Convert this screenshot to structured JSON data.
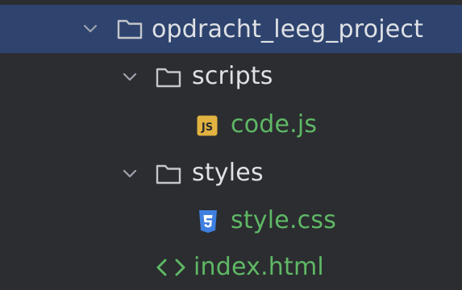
{
  "tree": {
    "items": [
      {
        "label": "opdracht_leeg_project",
        "type": "folder",
        "expanded": true,
        "selected": true,
        "icon": "folder-icon"
      },
      {
        "label": "scripts",
        "type": "folder",
        "expanded": true,
        "icon": "folder-icon"
      },
      {
        "label": "code.js",
        "type": "file",
        "icon": "js-file-icon",
        "icon_text": "JS"
      },
      {
        "label": "styles",
        "type": "folder",
        "expanded": true,
        "icon": "folder-icon"
      },
      {
        "label": "style.css",
        "type": "file",
        "icon": "css-file-icon"
      },
      {
        "label": "index.html",
        "type": "file",
        "icon": "html-file-icon",
        "icon_text": "<>"
      }
    ]
  },
  "colors": {
    "background": "#2b2d30",
    "selection": "#2e436e",
    "text": "#dfe1e5",
    "vcs_new_file": "#5fb865",
    "js_badge": "#e2b340",
    "css_badge": "#3f7fe0",
    "html_icon": "#5fb865"
  }
}
